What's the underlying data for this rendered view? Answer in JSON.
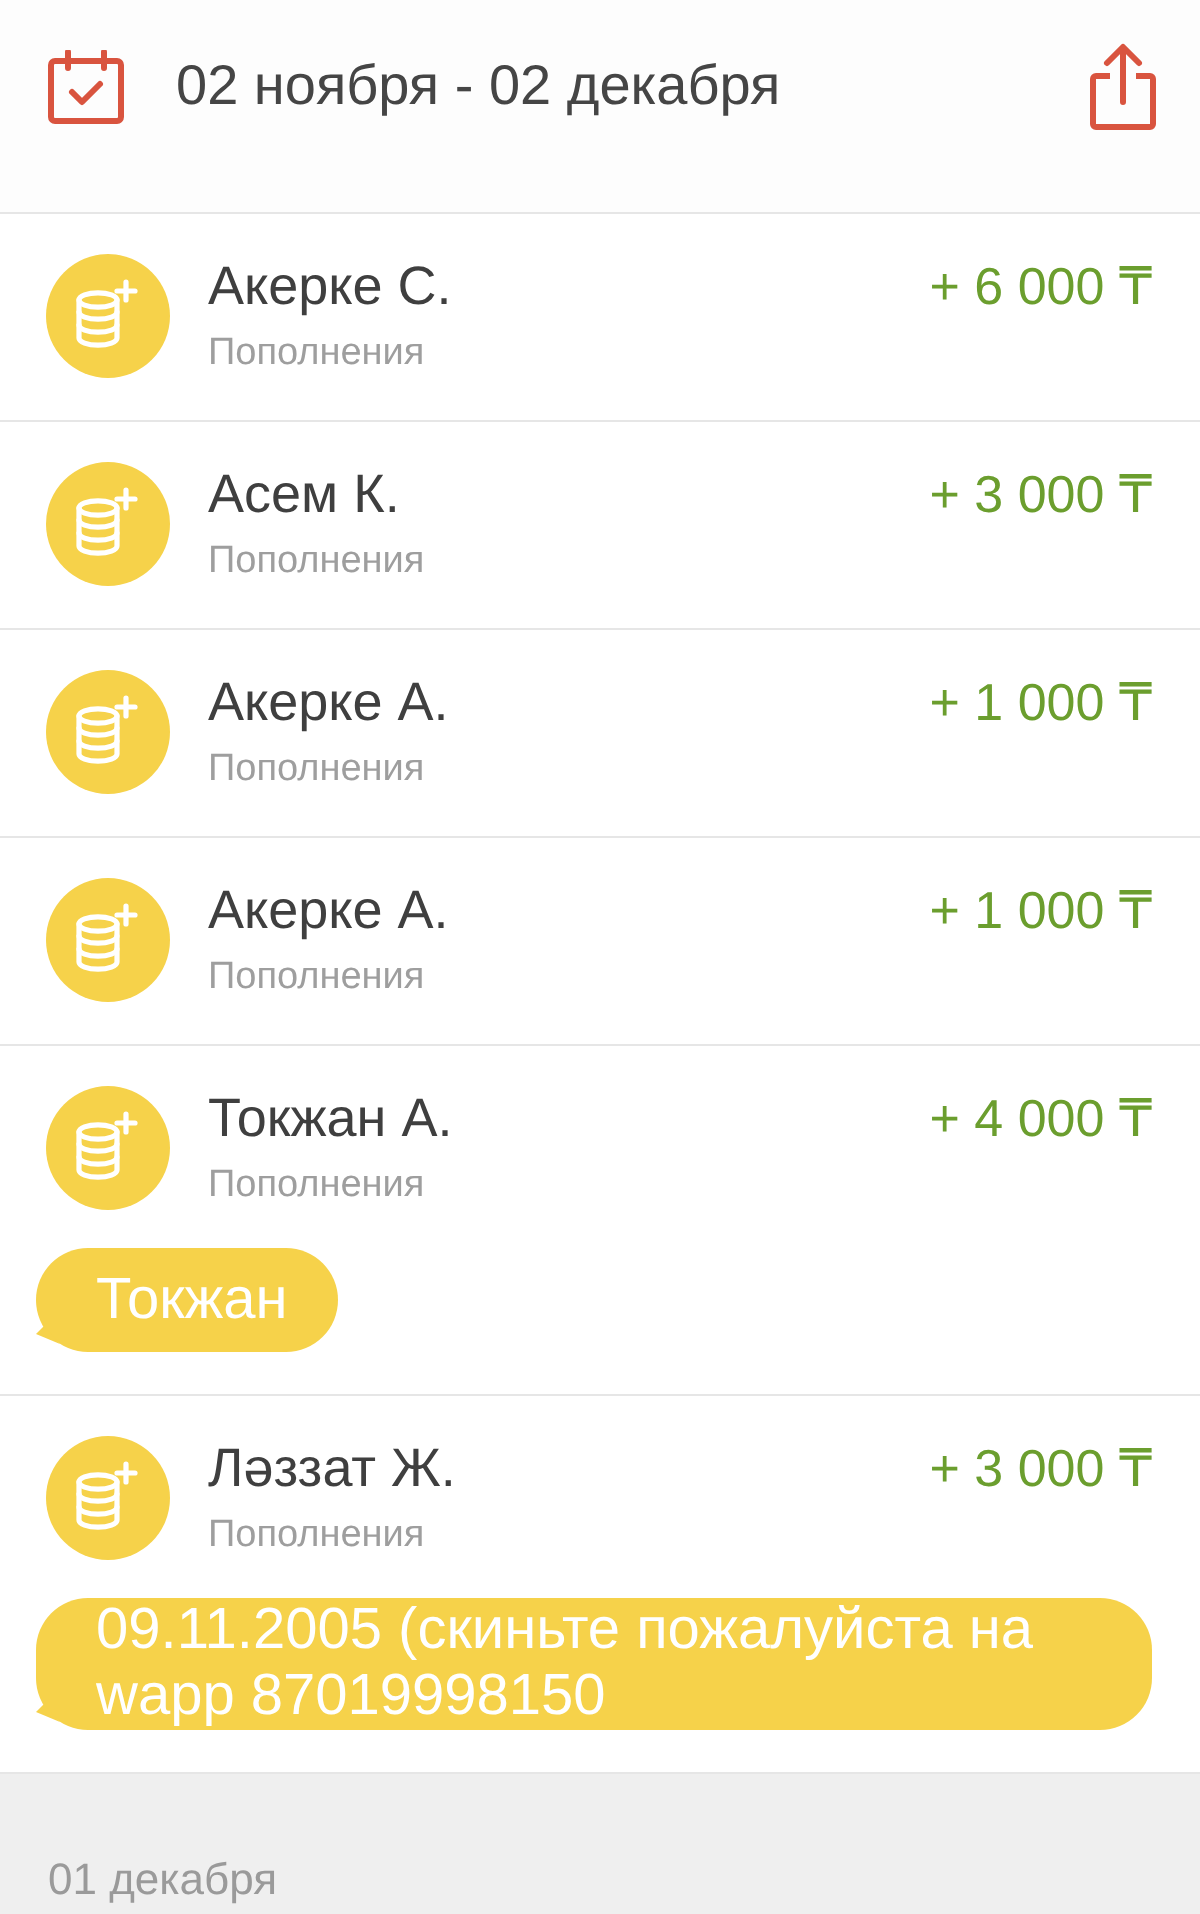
{
  "header": {
    "date_range": "02 ноября - 02 декабря"
  },
  "transactions": [
    {
      "name": "Акерке С.",
      "category": "Пополнения",
      "amount": "+ 6 000 ₸"
    },
    {
      "name": "Асем К.",
      "category": "Пополнения",
      "amount": "+ 3 000 ₸"
    },
    {
      "name": "Акерке А.",
      "category": "Пополнения",
      "amount": "+ 1 000 ₸"
    },
    {
      "name": "Акерке А.",
      "category": "Пополнения",
      "amount": "+ 1 000 ₸"
    },
    {
      "name": "Токжан А.",
      "category": "Пополнения",
      "amount": "+ 4 000 ₸",
      "message": "Токжан"
    },
    {
      "name": "Ләззат Ж.",
      "category": "Пополнения",
      "amount": "+ 3 000 ₸",
      "message": "09.11.2005 (скиньте пожалуйста на wapp 87019998150"
    }
  ],
  "next_section": {
    "date": "01 декабря"
  }
}
